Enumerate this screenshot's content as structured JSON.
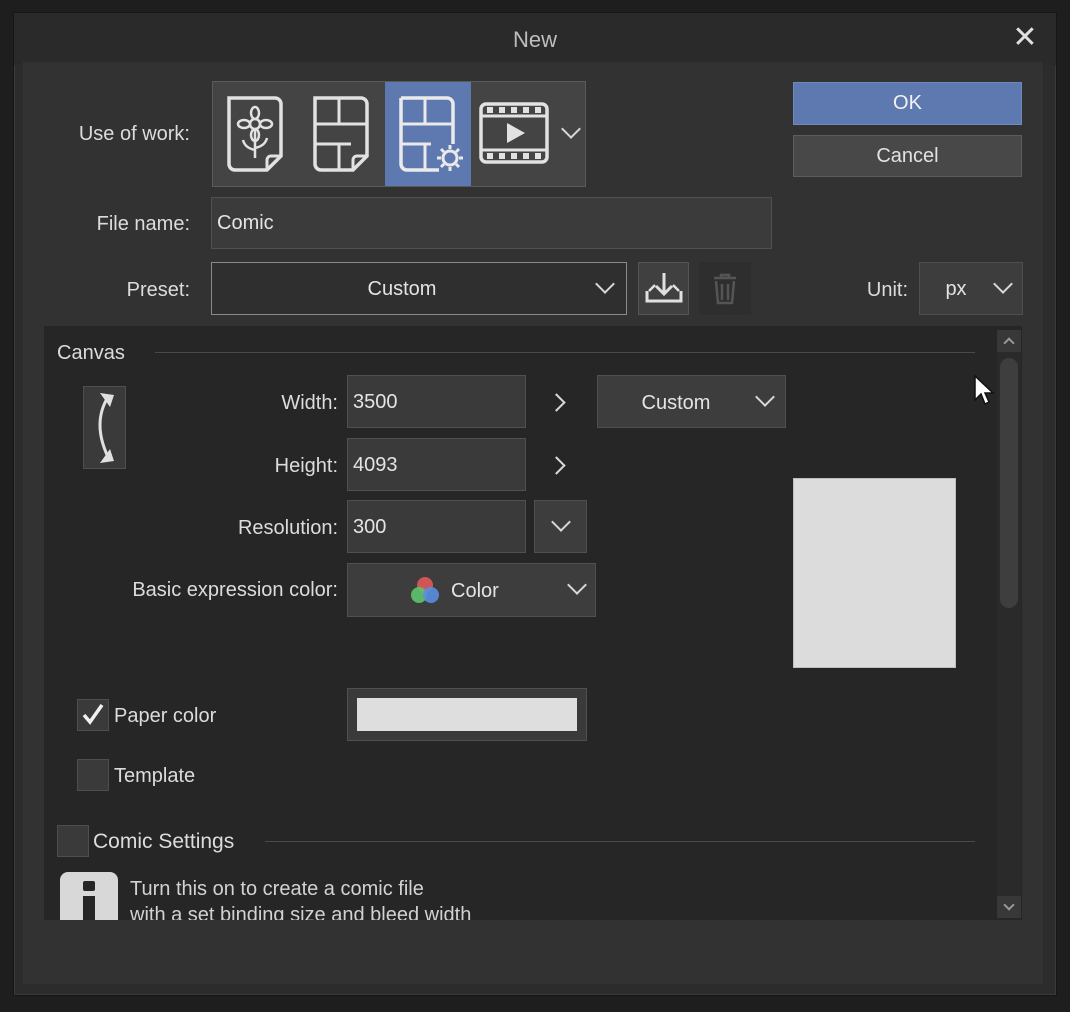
{
  "window": {
    "title": "New",
    "close_glyph": "✕"
  },
  "use_of_work": {
    "label": "Use of work:",
    "options": [
      {
        "icon": "illustration-icon",
        "selected": false
      },
      {
        "icon": "comic-icon",
        "selected": false
      },
      {
        "icon": "comic-settings-icon",
        "selected": true
      },
      {
        "icon": "animation-icon",
        "selected": false
      }
    ]
  },
  "buttons": {
    "ok": "OK",
    "cancel": "Cancel"
  },
  "file_name": {
    "label": "File name:",
    "value": "Comic"
  },
  "preset": {
    "label": "Preset:",
    "value": "Custom"
  },
  "unit": {
    "label": "Unit:",
    "value": "px"
  },
  "canvas": {
    "section_title": "Canvas",
    "width": {
      "label": "Width:",
      "value": "3500"
    },
    "height": {
      "label": "Height:",
      "value": "4093"
    },
    "size_preset": "Custom",
    "resolution": {
      "label": "Resolution:",
      "value": "300"
    },
    "basic_expression_color": {
      "label": "Basic expression color:",
      "value": "Color"
    },
    "paper_color": {
      "label": "Paper color",
      "checked": true,
      "swatch": "#dedede"
    },
    "template": {
      "label": "Template",
      "checked": false
    }
  },
  "comic_settings": {
    "label": "Comic Settings",
    "checked": false,
    "info_line1": "Turn this on to create a comic file",
    "info_line2": "with a set binding size and bleed width"
  },
  "colors": {
    "accent": "#5e78b0",
    "dialog_bg": "#2c2c2c",
    "panel_bg": "#262626",
    "preview_paper": "#dcdcdc"
  }
}
